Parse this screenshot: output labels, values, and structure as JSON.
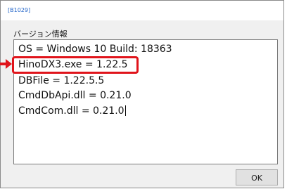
{
  "window": {
    "title": "[B1029]"
  },
  "group": {
    "label": "バージョン情報"
  },
  "version_info": {
    "lines": [
      "OS = Windows 10 Build: 18363",
      "HinoDX3.exe = 1.22.5",
      "DBFile = 1.22.5.5",
      "CmdDbApi.dll = 0.21.0",
      "CmdCom.dll = 0.21.0"
    ],
    "highlighted_line_index": 1
  },
  "buttons": {
    "ok_label": "OK"
  },
  "colors": {
    "highlight": "#e0141b",
    "title_text": "#1e62c8"
  },
  "icons": {
    "annotation_arrow": "arrow-right-icon"
  }
}
